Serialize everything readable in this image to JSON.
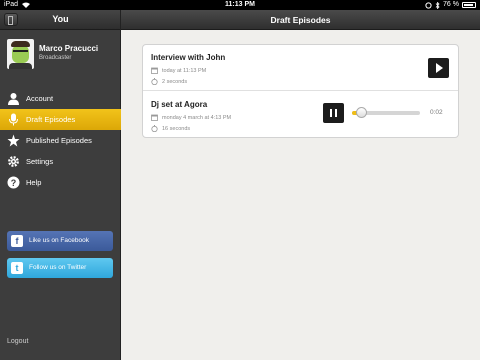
{
  "status_bar": {
    "carrier": "iPad",
    "time": "11:13 PM",
    "battery": "76 %"
  },
  "sidebar": {
    "title": "You",
    "profile": {
      "name": "Marco Pracucci",
      "role": "Broadcaster"
    },
    "nav": [
      {
        "label": "Account",
        "icon": "person-icon"
      },
      {
        "label": "Draft Episodes",
        "icon": "microphone-icon",
        "active": true
      },
      {
        "label": "Published Episodes",
        "icon": "star-icon"
      },
      {
        "label": "Settings",
        "icon": "gear-icon"
      },
      {
        "label": "Help",
        "icon": "help-icon"
      }
    ],
    "facebook_label": "Like us on Facebook",
    "twitter_label": "Follow us on Twitter",
    "logout_label": "Logout"
  },
  "main": {
    "title": "Draft Episodes",
    "episodes": [
      {
        "title": "Interview with John",
        "date": "today at 11:13 PM",
        "duration": "2 seconds",
        "state": "stopped"
      },
      {
        "title": "Dj set at Agora",
        "date": "monday 4 march at 4:13 PM",
        "duration": "16 seconds",
        "state": "playing",
        "elapsed": "0:02",
        "progress": 0.125
      }
    ]
  },
  "colors": {
    "accent": "#e9b50f",
    "facebook": "#3b5a9a",
    "twitter": "#2fa7dc"
  }
}
